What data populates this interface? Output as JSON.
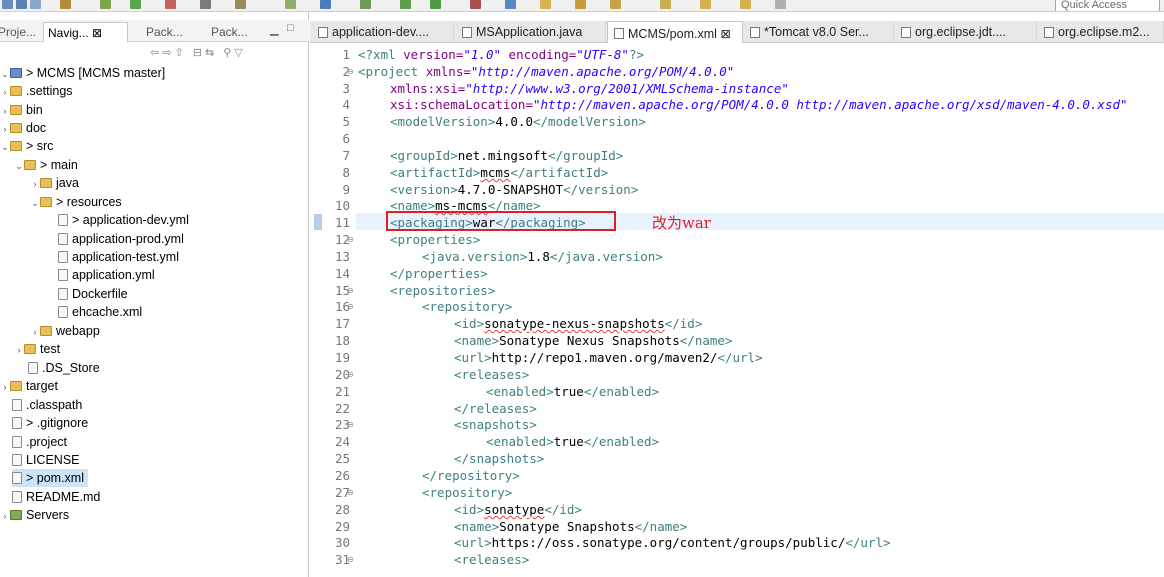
{
  "toolbar": {
    "quick_access_placeholder": "Quick Access"
  },
  "left_panel": {
    "tabs": [
      {
        "label": "Proje..."
      },
      {
        "label": "Navig... ⊠"
      },
      {
        "label": "Pack..."
      },
      {
        "label": "Pack..."
      }
    ],
    "tree": [
      {
        "label": "> MCMS  [MCMS master]"
      },
      {
        "label": ".settings"
      },
      {
        "label": "bin"
      },
      {
        "label": "doc"
      },
      {
        "label": "> src"
      },
      {
        "label": "> main"
      },
      {
        "label": "java"
      },
      {
        "label": "> resources"
      },
      {
        "label": "> application-dev.yml"
      },
      {
        "label": "application-prod.yml"
      },
      {
        "label": "application-test.yml"
      },
      {
        "label": "application.yml"
      },
      {
        "label": "Dockerfile"
      },
      {
        "label": "ehcache.xml"
      },
      {
        "label": "webapp"
      },
      {
        "label": "test"
      },
      {
        "label": ".DS_Store"
      },
      {
        "label": "target"
      },
      {
        "label": ".classpath"
      },
      {
        "label": "> .gitignore"
      },
      {
        "label": ".project"
      },
      {
        "label": "LICENSE"
      },
      {
        "label": "> pom.xml"
      },
      {
        "label": "README.md"
      },
      {
        "label": "Servers"
      }
    ]
  },
  "editor_tabs": [
    {
      "label": "application-dev...."
    },
    {
      "label": "MSApplication.java"
    },
    {
      "label": "MCMS/pom.xml ⊠"
    },
    {
      "label": "*Tomcat v8.0 Ser..."
    },
    {
      "label": "org.eclipse.jdt...."
    },
    {
      "label": "org.eclipse.m2..."
    }
  ],
  "editor": {
    "line_numbers": [
      "1",
      "2",
      "3",
      "4",
      "5",
      "6",
      "7",
      "8",
      "9",
      "10",
      "11",
      "12",
      "13",
      "14",
      "15",
      "16",
      "17",
      "18",
      "19",
      "20",
      "21",
      "22",
      "23",
      "24",
      "25",
      "26",
      "27",
      "28",
      "29",
      "30",
      "31"
    ],
    "lines": {
      "l1": {
        "a": "<?xml ",
        "b": "version=",
        "c": "\"1.0\"",
        "d": " encoding=",
        "e": "\"UTF-8\"",
        "f": "?>"
      },
      "l2": {
        "a": "<project ",
        "b": "xmlns=",
        "c": "\"http://maven.apache.org/POM/4.0.0\""
      },
      "l3": {
        "b": "xmlns:xsi=",
        "c": "\"http://www.w3.org/2001/XMLSchema-instance\""
      },
      "l4": {
        "b": "xsi:schemaLocation=",
        "c": "\"http://maven.apache.org/POM/4.0.0 http://maven.apache.org/xsd/maven-4.0.0.xsd\""
      },
      "l5": {
        "a": "<modelVersion>",
        "t": "4.0.0",
        "z": "</modelVersion>"
      },
      "l7": {
        "a": "<groupId>",
        "t": "net.mingsoft",
        "z": "</groupId>"
      },
      "l8": {
        "a": "<artifactId>",
        "t": "mcms",
        "z": "</artifactId>"
      },
      "l9": {
        "a": "<version>",
        "t": "4.7.0-SNAPSHOT",
        "z": "</version>"
      },
      "l10": {
        "a": "<name>",
        "t": "ms-mcms",
        "z": "</name>"
      },
      "l11": {
        "a": "<packaging>",
        "t": "war",
        "z": "</packaging>"
      },
      "l12": {
        "a": "<properties>"
      },
      "l13": {
        "a": "<java.version>",
        "t": "1.8",
        "z": "</java.version>"
      },
      "l14": {
        "a": "</properties>"
      },
      "l15": {
        "a": "<repositories>"
      },
      "l16": {
        "a": "<repository>"
      },
      "l17": {
        "a": "<id>",
        "t": "sonatype-nexus-snapshots",
        "z": "</id>"
      },
      "l18": {
        "a": "<name>",
        "t": "Sonatype Nexus Snapshots",
        "z": "</name>"
      },
      "l19": {
        "a": "<url>",
        "t": "http://repo1.maven.org/maven2/",
        "z": "</url>"
      },
      "l20": {
        "a": "<releases>"
      },
      "l21": {
        "a": "<enabled>",
        "t": "true",
        "z": "</enabled>"
      },
      "l22": {
        "a": "</releases>"
      },
      "l23": {
        "a": "<snapshots>"
      },
      "l24": {
        "a": "<enabled>",
        "t": "true",
        "z": "</enabled>"
      },
      "l25": {
        "a": "</snapshots>"
      },
      "l26": {
        "a": "</repository>"
      },
      "l27": {
        "a": "<repository>"
      },
      "l28": {
        "a": "<id>",
        "t": "sonatype",
        "z": "</id>"
      },
      "l29": {
        "a": "<name>",
        "t": "Sonatype Snapshots",
        "z": "</name>"
      },
      "l30": {
        "a": "<url>",
        "t": "https://oss.sonatype.org/content/groups/public/",
        "z": "</url>"
      },
      "l31": {
        "a": "<releases>"
      }
    },
    "annotation": "改为war"
  },
  "colors": {
    "tag": "#3f7f7f",
    "attr": "#7f007f",
    "value": "#2a00ff",
    "highlight_box": "#e02020"
  }
}
